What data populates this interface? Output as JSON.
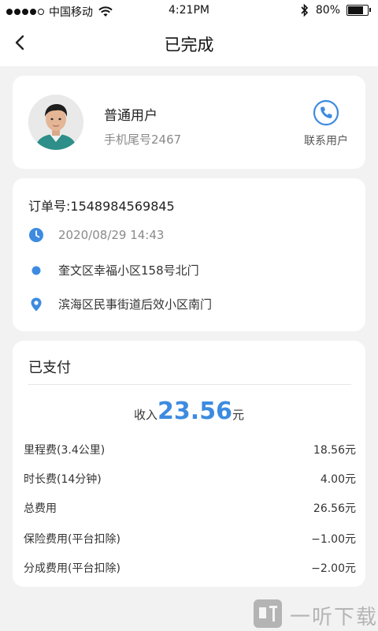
{
  "status_bar": {
    "carrier": "中国移动",
    "time": "4:21PM",
    "battery_text": "80%",
    "battery_level": 0.8,
    "icons": [
      "signal-dots-icon",
      "wifi-icon",
      "bluetooth-icon",
      "battery-icon"
    ]
  },
  "nav": {
    "title": "已完成",
    "back_icon": "back-arrow-icon"
  },
  "user_card": {
    "name": "普通用户",
    "phone_hint": "手机尾号2467",
    "contact_label": "联系用户",
    "contact_icon": "phone-icon"
  },
  "order": {
    "order_no": "订单号:1548984569845",
    "time": "2020/08/29   14:43",
    "start_address": "奎文区幸福小区158号北门",
    "end_address": "滨海区民事街道后效小区南门",
    "icons": [
      "clock-icon",
      "start-dot-icon",
      "location-pin-icon"
    ]
  },
  "payment": {
    "title": "已支付",
    "income_prefix": "收入",
    "income_amount": "23.56",
    "income_suffix": "元",
    "fees": [
      {
        "label": "里程费(3.4公里)",
        "value": "18.56元"
      },
      {
        "label": "时长费(14分钟)",
        "value": "4.00元"
      },
      {
        "label": "总费用",
        "value": "26.56元"
      },
      {
        "label": "保险费用(平台扣除)",
        "value": "−1.00元"
      },
      {
        "label": "分成费用(平台扣除)",
        "value": "−2.00元"
      }
    ]
  },
  "watermark": {
    "text": "一听下载"
  },
  "colors": {
    "accent": "#3d8be0",
    "background": "#f2f2f2",
    "card": "#ffffff"
  }
}
